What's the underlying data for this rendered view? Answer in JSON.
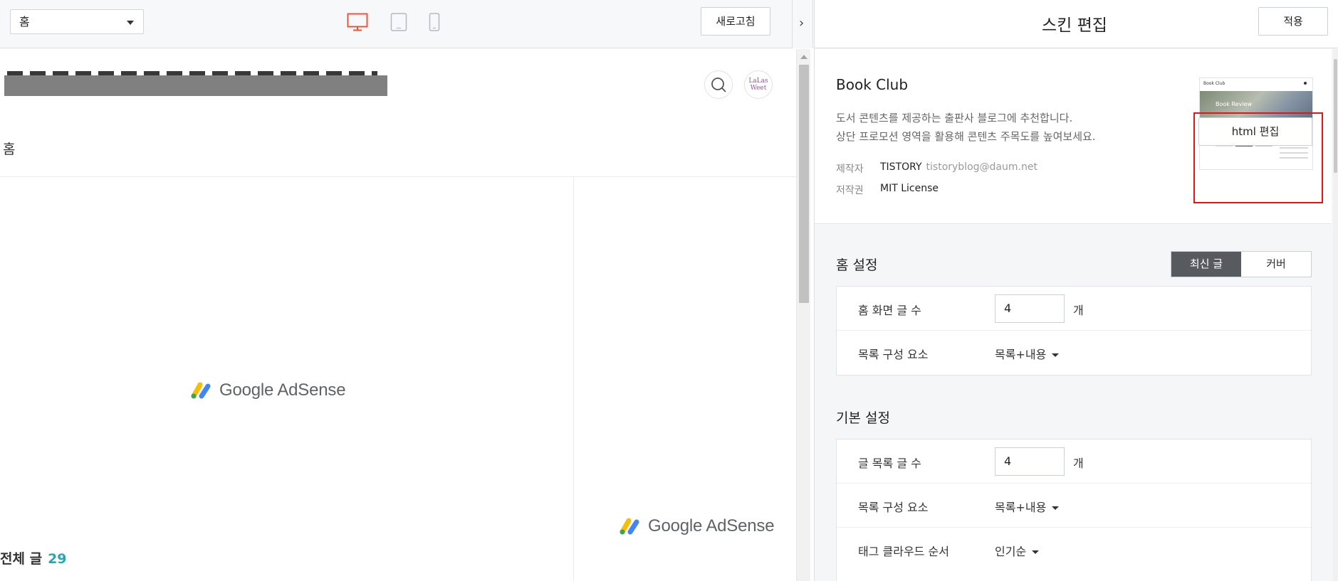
{
  "toolbar": {
    "page_select_value": "홈",
    "refresh_label": "새로고침",
    "collapse_arrow": "›",
    "devices": [
      "desktop",
      "tablet",
      "mobile"
    ],
    "active_device": "desktop",
    "active_color": "#e8563f"
  },
  "preview": {
    "avatar_text": "LaLas Weet",
    "nav_home": "홈",
    "ad_label_main": "Google AdSense",
    "ad_label_side": "Google AdSense",
    "total_posts_label": "전체 글",
    "total_posts_count": "29",
    "count_color": "#27a7b5"
  },
  "editor": {
    "title": "스킨 편집",
    "apply_label": "적용",
    "skin": {
      "name": "Book Club",
      "desc_line1": "도서 콘텐츠를 제공하는 출판사 블로그에 추천합니다.",
      "desc_line2": "상단 프로모션 영역을 활용해 콘텐츠 주목도를 높여보세요.",
      "maker_key": "제작자",
      "maker_name": "TISTORY",
      "maker_email": "tistoryblog@daum.net",
      "license_key": "저작권",
      "license_value": "MIT License",
      "thumb_title": "Book Club",
      "thumb_hero_text": "Book Review",
      "html_edit_label": "html 편집"
    },
    "home_settings": {
      "title": "홈 설정",
      "seg_latest": "최신 글",
      "seg_cover": "커버",
      "rows": [
        {
          "label": "홈 화면 글 수",
          "value": "4",
          "unit": "개"
        },
        {
          "label": "목록 구성 요소",
          "value": "목록+내용"
        }
      ]
    },
    "basic_settings": {
      "title": "기본 설정",
      "rows": [
        {
          "label": "글 목록 글 수",
          "value": "4",
          "unit": "개"
        },
        {
          "label": "목록 구성 요소",
          "value": "목록+내용"
        },
        {
          "label": "태그 클라우드 순서",
          "value": "인기순"
        }
      ]
    },
    "highlight_color": "#e3151a"
  }
}
